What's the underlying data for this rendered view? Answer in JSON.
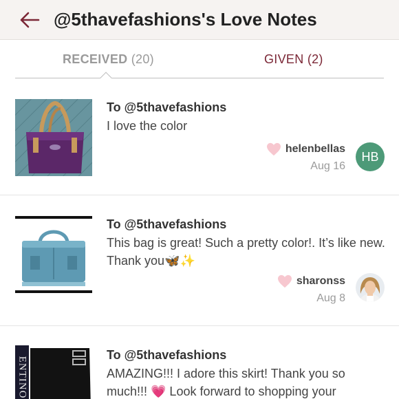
{
  "header": {
    "back_icon": "back-arrow-icon",
    "title": "@5thavefashions's Love Notes"
  },
  "tabs": {
    "received_label": "RECEIVED",
    "received_count": "(20)",
    "given_label": "GIVEN (2)"
  },
  "notes": [
    {
      "to": "To @5thavefashions",
      "message": "I love the color",
      "sender": "helenbellas",
      "date": "Aug 16",
      "avatar_initials": "HB"
    },
    {
      "to": "To @5thavefashions",
      "message": "This bag is great! Such a pretty color!. It’s like new. Thank you🦋✨",
      "sender": "sharonss",
      "date": "Aug 8"
    },
    {
      "to": "To @5thavefashions",
      "message": "AMAZING!!! I adore this skirt! Thank you so much!!! 💗 Look forward to shopping your",
      "thumb_text": "ENTINO"
    }
  ],
  "colors": {
    "accent": "#7b2736",
    "avatar_green": "#4d9a78",
    "heart": "#f7c7cf"
  }
}
